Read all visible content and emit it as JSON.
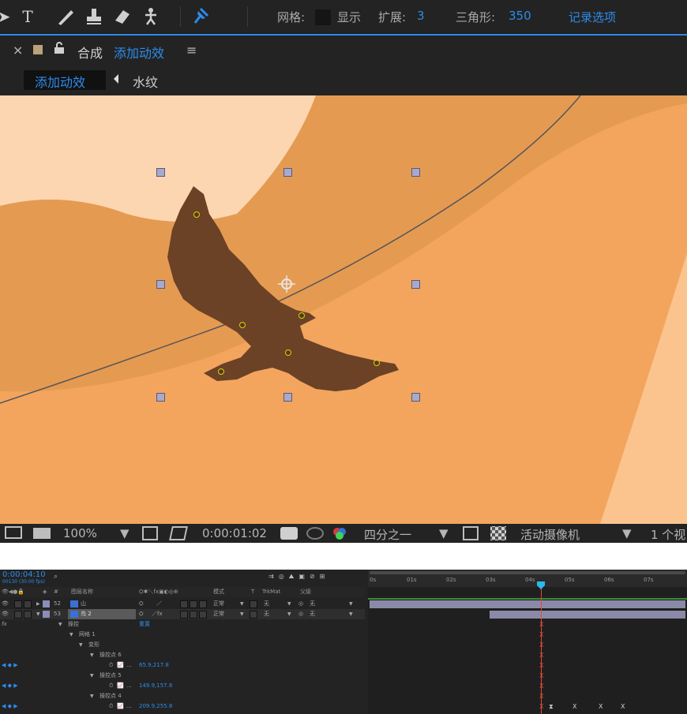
{
  "toolbar": {
    "tools": [
      "pointer-icon",
      "type-icon",
      "brush-icon",
      "clone-stamp-icon",
      "eraser-icon",
      "roto-brush-icon",
      "puppet-pin-icon"
    ],
    "mesh_label": "网格:",
    "show_label": "显示",
    "expand_label": "扩展:",
    "expand_value": "3",
    "triangles_label": "三角形:",
    "triangles_value": "350",
    "record_options": "记录选项"
  },
  "comp": {
    "close": "×",
    "lock": "🔓",
    "panel_title": "合成",
    "comp_name": "添加动效",
    "menu": "≡",
    "breadcrumb": [
      "添加动效",
      "水纹"
    ]
  },
  "viewer_bar": {
    "zoom": "100%",
    "timecode": "0:00:01:02",
    "resolution": "四分之一",
    "camera": "活动摄像机",
    "views": "1 个视"
  },
  "timeline": {
    "current_time": "0:00:04:10",
    "fps": "00130 (30.00 fps)",
    "search_icon": "search-icon",
    "columns": {
      "hash": "#",
      "layer_name": "图层名称",
      "mode": "模式",
      "t": "T",
      "trkmat": "TrkMat",
      "parent": "父级"
    },
    "ruler": [
      "0s",
      "01s",
      "02s",
      "03s",
      "04s",
      "05s",
      "06s",
      "07s"
    ],
    "layers": [
      {
        "num": "52",
        "name": "山",
        "mode": "正常",
        "trkmat": "无",
        "parent": "无",
        "color": "#8c8cb8"
      },
      {
        "num": "53",
        "name": "鸟 2",
        "mode": "正常",
        "trkmat": "无",
        "parent": "无",
        "color": "#8c8cb8"
      }
    ],
    "props": {
      "fx": "fx",
      "puppet": "操控",
      "reset": "重置",
      "mesh1": "网格 1",
      "deform": "变形",
      "pin6": "操控点 6",
      "pin6_value": "65.9,217.8",
      "pin5": "操控点 5",
      "pin5_value": "149.9,157.8",
      "pin4": "操控点 4",
      "pin4_value": "209.9,255.8"
    },
    "ellipsis": "..."
  }
}
